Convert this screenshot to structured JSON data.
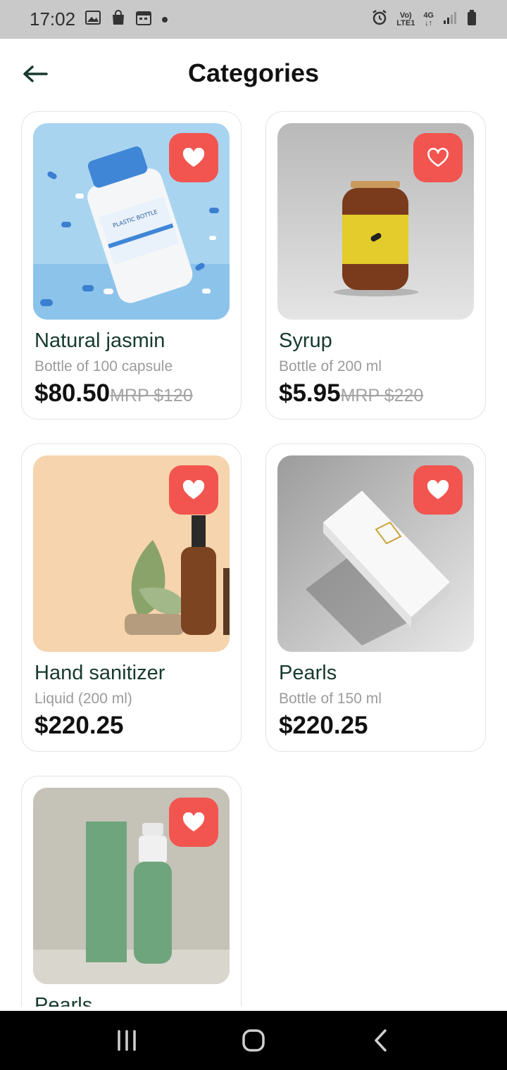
{
  "status_bar": {
    "time": "17:02",
    "left_icons": [
      "image-icon",
      "shopping-bag-icon",
      "calendar-icon",
      "dot-icon"
    ],
    "network_top": "Vo)",
    "network_bottom": "LTE1",
    "network_gen": "4G",
    "right_icons": [
      "alarm-icon",
      "signal-icon",
      "battery-icon"
    ]
  },
  "header": {
    "title": "Categories",
    "back_icon": "arrow-left-icon"
  },
  "products": [
    {
      "name": "Natural jasmin",
      "subtitle": "Bottle of 100 capsule",
      "price": "$80.50",
      "mrp": "MRP $120",
      "favorite": true,
      "image": "vitamin-bottle-blue"
    },
    {
      "name": "Syrup",
      "subtitle": "Bottle of 200 ml",
      "price": "$5.95",
      "mrp": "MRP $220",
      "favorite": false,
      "image": "amber-jar-yellow-label"
    },
    {
      "name": "Hand sanitizer",
      "subtitle": "Liquid (200 ml)",
      "price": "$220.25",
      "mrp": "",
      "favorite": true,
      "image": "dropper-bottle-leaves"
    },
    {
      "name": "Pearls",
      "subtitle": "Bottle of 150 ml",
      "price": "$220.25",
      "mrp": "",
      "favorite": true,
      "image": "white-box"
    },
    {
      "name": "Pearls",
      "subtitle": "",
      "price": "",
      "mrp": "",
      "favorite": true,
      "image": "green-spray-box"
    }
  ],
  "colors": {
    "favorite_bg": "#f2554f",
    "name_text": "#163a2d",
    "status_bar_bg": "#c9c9c9",
    "nav_bar_bg": "#000000"
  },
  "nav_bar": {
    "icons": [
      "recent-apps-icon",
      "home-icon",
      "back-icon"
    ]
  }
}
